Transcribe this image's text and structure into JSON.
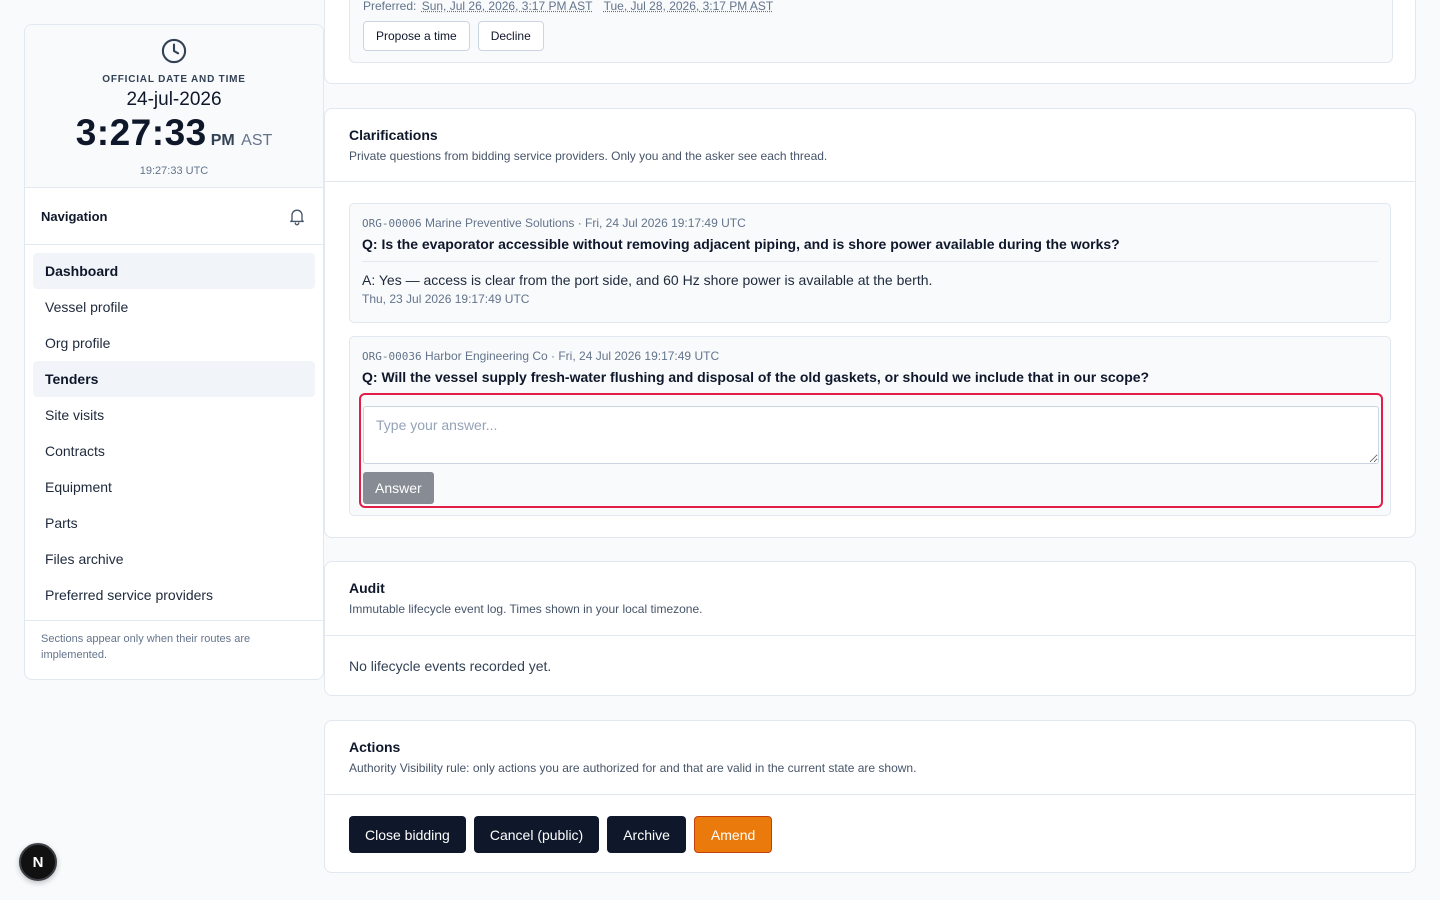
{
  "clock": {
    "caption": "OFFICIAL DATE AND TIME",
    "date": "24-jul-2026",
    "time": "3:27:33",
    "ampm": "PM",
    "timezone": "AST",
    "utc": "19:27:33 UTC",
    "icon": "clock-icon"
  },
  "navigation": {
    "title": "Navigation",
    "bell_icon": "bell-icon",
    "items": [
      {
        "label": "Dashboard",
        "active": true
      },
      {
        "label": "Vessel profile",
        "active": false
      },
      {
        "label": "Org profile",
        "active": false
      },
      {
        "label": "Tenders",
        "active": true
      },
      {
        "label": "Site visits",
        "active": false
      },
      {
        "label": "Contracts",
        "active": false
      },
      {
        "label": "Equipment",
        "active": false
      },
      {
        "label": "Parts",
        "active": false
      },
      {
        "label": "Files archive",
        "active": false
      },
      {
        "label": "Preferred service providers",
        "active": false
      }
    ],
    "note": "Sections appear only when their routes are implemented."
  },
  "site_visit": {
    "preferred_label": "Preferred:",
    "preferred_dates": [
      "Sun, Jul 26, 2026, 3:17 PM AST",
      "Tue, Jul 28, 2026, 3:17 PM AST"
    ],
    "propose_label": "Propose a time",
    "decline_label": "Decline"
  },
  "clarifications": {
    "title": "Clarifications",
    "subtitle": "Private questions from bidding service providers. Only you and the asker see each thread.",
    "threads": [
      {
        "org_id": "ORG-00006",
        "meta": "Marine Preventive Solutions · Fri, 24 Jul 2026 19:17:49 UTC",
        "question": "Q: Is the evaporator accessible without removing adjacent piping, and is shore power available during the works?",
        "answer": "A: Yes — access is clear from the port side, and 60 Hz shore power is available at the berth.",
        "answer_time": "Thu, 23 Jul 2026 19:17:49 UTC"
      },
      {
        "org_id": "ORG-00036",
        "meta": "Harbor Engineering Co · Fri, 24 Jul 2026 19:17:49 UTC",
        "question": "Q: Will the vessel supply fresh-water flushing and disposal of the old gaskets, or should we include that in our scope?",
        "answer_placeholder": "Type your answer...",
        "answer_button": "Answer"
      }
    ]
  },
  "audit": {
    "title": "Audit",
    "subtitle": "Immutable lifecycle event log. Times shown in your local timezone.",
    "empty": "No lifecycle events recorded yet."
  },
  "actions": {
    "title": "Actions",
    "subtitle": "Authority Visibility rule: only actions you are authorized for and that are valid in the current state are shown.",
    "close_bidding": "Close bidding",
    "cancel_public": "Cancel (public)",
    "archive": "Archive",
    "amend": "Amend"
  },
  "badge": {
    "letter": "N"
  },
  "colors": {
    "highlight_border": "#e11d48",
    "primary_dark": "#0f172a",
    "amend_orange": "#ea7a0c",
    "answer_button_gray": "#868b94"
  }
}
